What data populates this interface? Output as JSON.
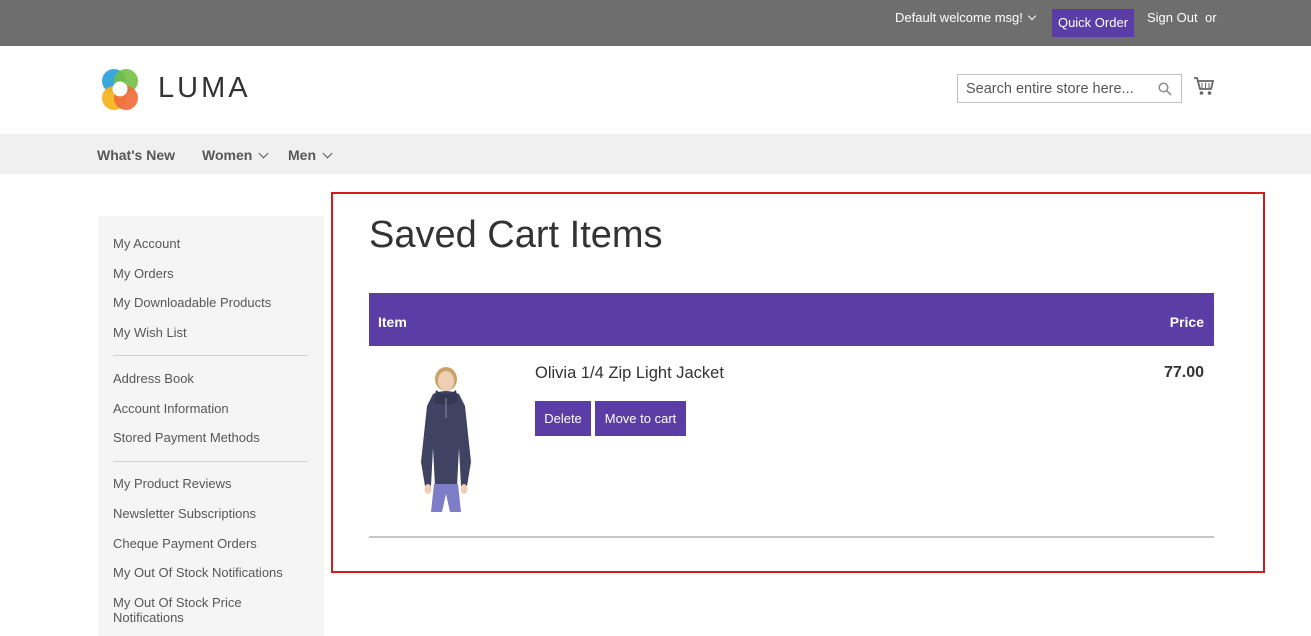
{
  "topbar": {
    "welcome": "Default welcome msg!",
    "quick_order": "Quick Order",
    "sign_out": "Sign Out",
    "or": "or"
  },
  "header": {
    "logo_text": "LUMA",
    "search_placeholder": "Search entire store here...",
    "icons": [
      "search-icon",
      "cart-icon",
      "luma-logo-icon"
    ]
  },
  "nav": {
    "items": [
      "What's New",
      "Women",
      "Men"
    ]
  },
  "sidebar": {
    "group1": [
      "My Account",
      "My Orders",
      "My Downloadable Products",
      "My Wish List"
    ],
    "group2": [
      "Address Book",
      "Account Information",
      "Stored Payment Methods"
    ],
    "group3": [
      "My Product Reviews",
      "Newsletter Subscriptions",
      "Cheque Payment Orders",
      "My Out Of Stock Notifications",
      "My Out Of Stock Price",
      "Notifications"
    ]
  },
  "main": {
    "title": "Saved Cart Items",
    "columns": {
      "item": "Item",
      "price": "Price"
    },
    "rows": [
      {
        "name": "Olivia 1/4 Zip Light Jacket",
        "price": "77.00",
        "delete_label": "Delete",
        "move_label": "Move to cart"
      }
    ]
  },
  "colors": {
    "accent": "#5a3ea6",
    "topbar": "#6e6e6e",
    "highlight_frame": "#d31c22"
  }
}
